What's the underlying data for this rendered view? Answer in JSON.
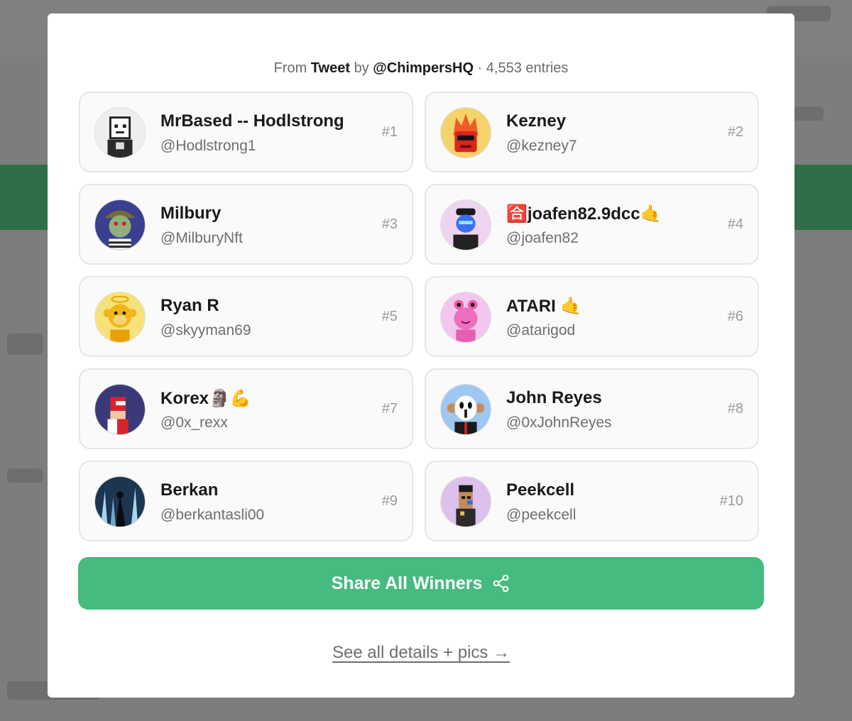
{
  "header": {
    "prefix": "From",
    "source": "Tweet",
    "by": "by",
    "author": "@ChimpersHQ",
    "separator": "·",
    "entries": "4,553 entries"
  },
  "winners": [
    {
      "name": "MrBased -- Hodlstrong",
      "handle": "@Hodlstrong1",
      "rank": "#1",
      "avatar_icon": "pixel-ape-avatar-icon"
    },
    {
      "name": "Kezney",
      "handle": "@kezney7",
      "rank": "#2",
      "avatar_icon": "fire-head-avatar-icon"
    },
    {
      "name": "Milbury",
      "handle": "@MilburyNft",
      "rank": "#3",
      "avatar_icon": "bored-ape-avatar-icon"
    },
    {
      "name": "🈴joafen82.9dcc🤙",
      "handle": "@joafen82",
      "rank": "#4",
      "avatar_icon": "robot-avatar-icon"
    },
    {
      "name": "Ryan R",
      "handle": "@skyyman69",
      "rank": "#5",
      "avatar_icon": "golden-monkey-avatar-icon"
    },
    {
      "name": "ATARI 🤙",
      "handle": "@atarigod",
      "rank": "#6",
      "avatar_icon": "pink-creature-avatar-icon"
    },
    {
      "name": "Korex🗿💪",
      "handle": "@0x_rexx",
      "rank": "#7",
      "avatar_icon": "pixel-character-avatar-icon"
    },
    {
      "name": "John Reyes",
      "handle": "@0xJohnReyes",
      "rank": "#8",
      "avatar_icon": "masked-ape-avatar-icon"
    },
    {
      "name": "Berkan",
      "handle": "@berkantasli00",
      "rank": "#9",
      "avatar_icon": "dark-forest-avatar-icon"
    },
    {
      "name": "Peekcell",
      "handle": "@peekcell",
      "rank": "#10",
      "avatar_icon": "pixel-punk-avatar-icon"
    }
  ],
  "share_button": {
    "label": "Share All Winners",
    "icon": "share-icon"
  },
  "details_link": {
    "label": "See all details + pics →"
  },
  "colors": {
    "accent": "#45bb7f",
    "card_bg": "#fafafa",
    "card_border": "#e6e6e6",
    "backdrop": "#7d7d7d"
  }
}
